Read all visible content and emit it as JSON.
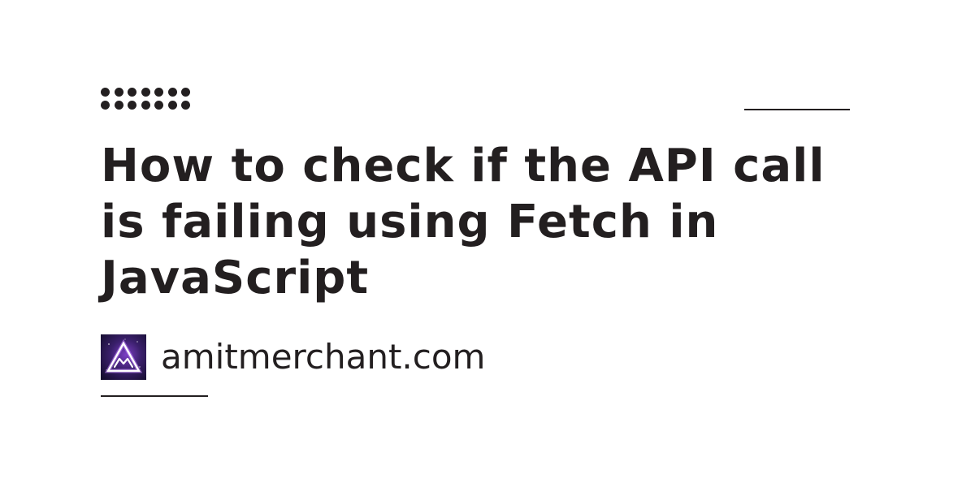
{
  "title": "How to check if the API call is failing using Fetch in JavaScript",
  "site": "amitmerchant.com",
  "logo": {
    "icon": "mountain-triangle-logo",
    "colors": {
      "background": "#3a1f6b",
      "stroke": "#ffffff",
      "glow": "#c084fc"
    }
  },
  "colors": {
    "text": "#231f20",
    "background": "#ffffff"
  }
}
